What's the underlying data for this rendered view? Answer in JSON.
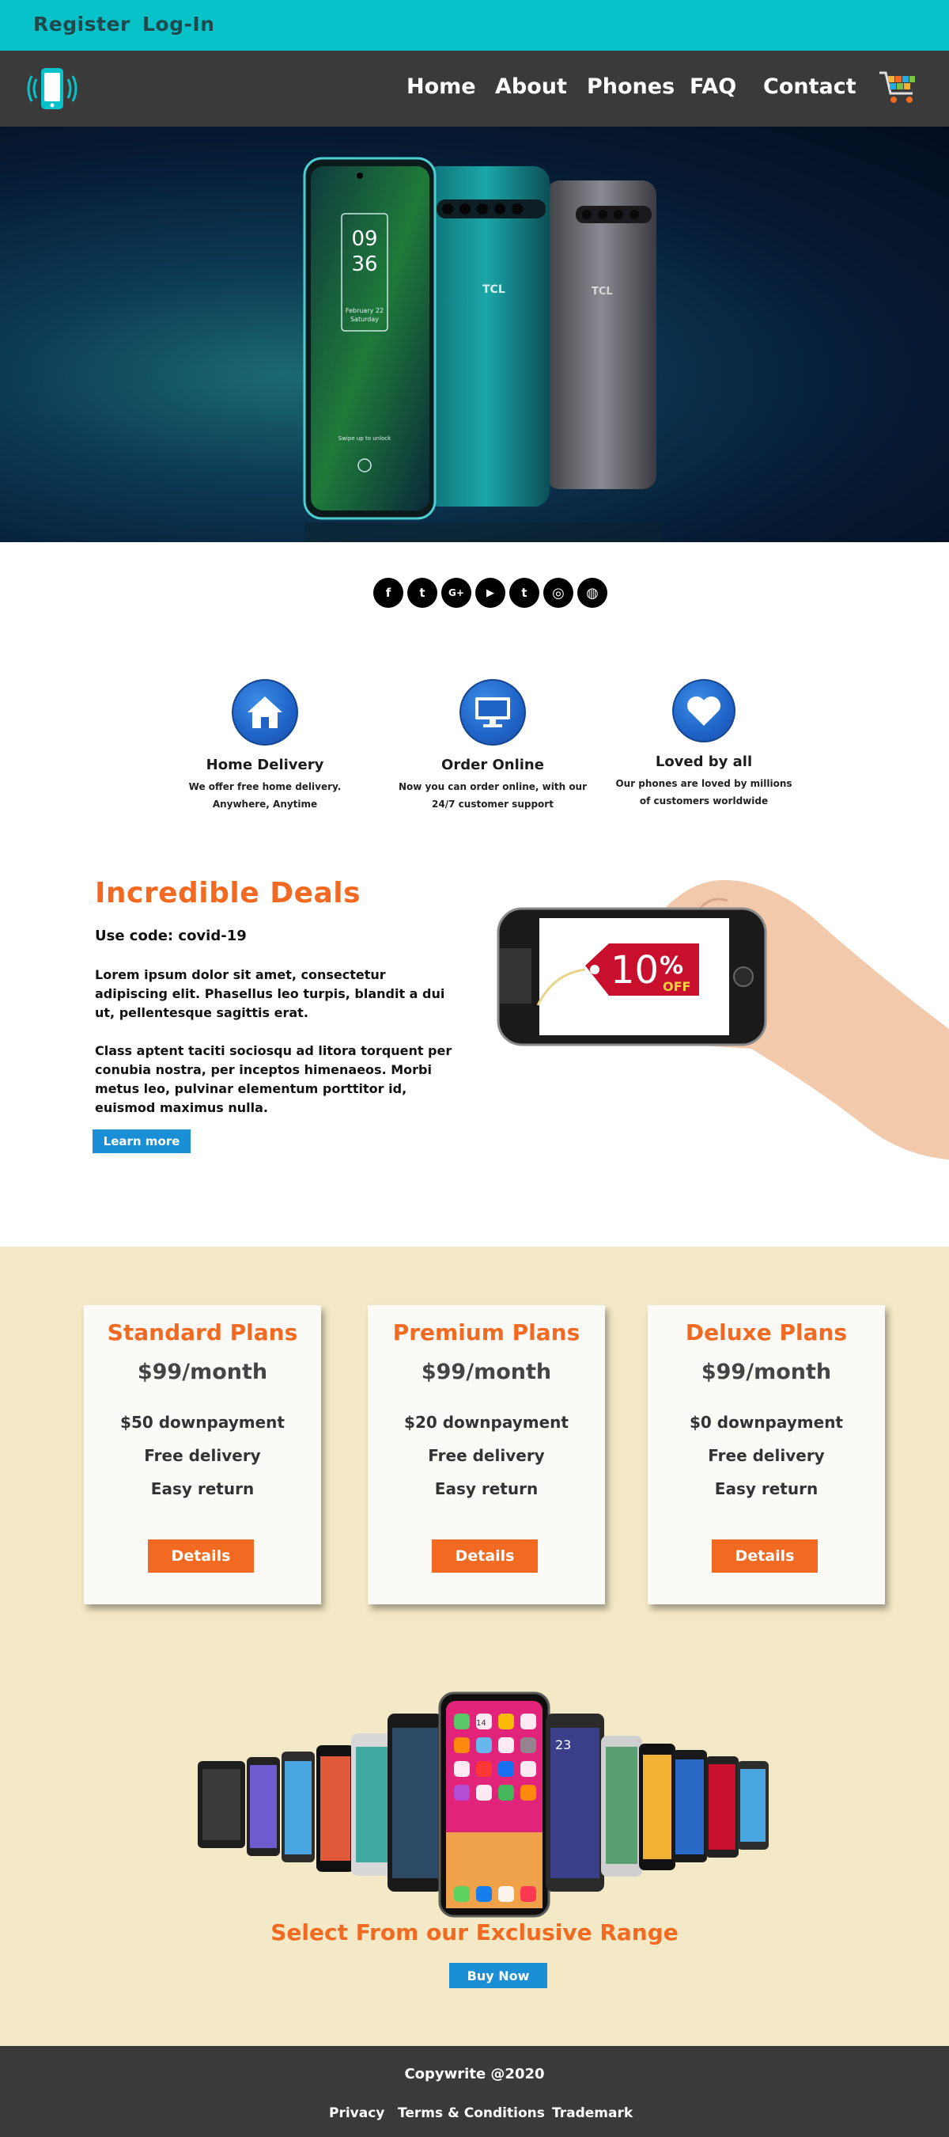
{
  "topbar": {
    "register": "Register",
    "login": "Log-In"
  },
  "nav": {
    "home": "Home",
    "about": "About",
    "phones": "Phones",
    "faq": "FAQ",
    "contact": "Contact"
  },
  "hero": {
    "time_hour": "09",
    "time_min": "36",
    "date": "February 22",
    "day": "Saturday",
    "brand": "TCL",
    "unlock_hint": "Swipe up to unlock"
  },
  "social": {
    "facebook": "f",
    "twitter": "t",
    "google": "G+",
    "youtube": "▶",
    "tumblr": "t",
    "instagram": "◎",
    "dribbble": "◍"
  },
  "features": [
    {
      "title": "Home Delivery",
      "line1": "We offer free home delivery.",
      "line2": "Anywhere, Anytime"
    },
    {
      "title": "Order Online",
      "line1": "Now you can order online, with our",
      "line2": "24/7 customer support"
    },
    {
      "title": "Loved by all",
      "line1": "Our phones are loved by millions",
      "line2": "of customers worldwide"
    }
  ],
  "deals": {
    "title": "Incredible Deals",
    "code": "Use code: covid-19",
    "para1": "Lorem ipsum dolor sit amet, consectetur adipiscing elit. Phasellus leo turpis, blandit a dui ut, pellentesque sagittis erat.",
    "para2": "Class aptent taciti sociosqu ad litora torquent per conubia nostra, per inceptos himenaeos. Morbi metus leo, pulvinar elementum porttitor id, euismod maximus nulla.",
    "learn_more": "Learn more",
    "tag_percent": "10",
    "tag_sign": "%",
    "tag_off": "OFF"
  },
  "plans": [
    {
      "name": "Standard Plans",
      "price": "$99/month",
      "downpayment": "$50 downpayment",
      "delivery": "Free delivery",
      "return": "Easy return",
      "button": "Details"
    },
    {
      "name": "Premium Plans",
      "price": "$99/month",
      "downpayment": "$20 downpayment",
      "delivery": "Free delivery",
      "return": "Easy return",
      "button": "Details"
    },
    {
      "name": "Deluxe Plans",
      "price": "$99/month",
      "downpayment": "$0 downpayment",
      "delivery": "Free delivery",
      "return": "Easy return",
      "button": "Details"
    }
  ],
  "range": {
    "title": "Select From our Exclusive Range",
    "button": "Buy Now",
    "phone_time": "23",
    "phone_date": "14"
  },
  "footer": {
    "copyright": "Copywrite @2020",
    "privacy": "Privacy",
    "terms": "Terms & Conditions",
    "trademark": "Trademark"
  },
  "colors": {
    "teal": "#07c3c9",
    "dark": "#3a3a3a",
    "orange": "#f26a21",
    "blue": "#1a8fd6",
    "cream": "#f3e9c6"
  }
}
